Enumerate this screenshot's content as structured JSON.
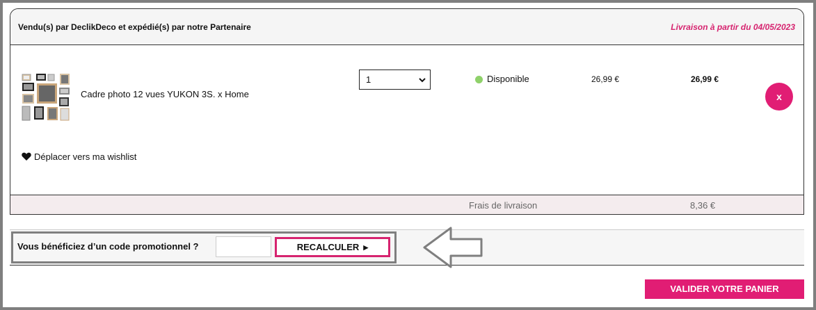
{
  "order": {
    "seller_line": "Vendu(s) par DeclikDeco et expédié(s) par notre Partenaire",
    "delivery_line": "Livraison à partir du 04/05/2023"
  },
  "item": {
    "name": "Cadre photo 12 vues YUKON 3S. x Home",
    "quantity": "1",
    "availability": "Disponible",
    "unit_price": "26,99 €",
    "total_price": "26,99 €",
    "remove_label": "x",
    "wishlist_label": "Déplacer vers ma wishlist",
    "availability_color": "#8fd16a"
  },
  "shipping": {
    "label": "Frais de livraison",
    "value": "8,36 €"
  },
  "promo": {
    "label": "Vous bénéficiez d’un code promotionnel ?",
    "input_value": "",
    "recalc_label": "RECALCULER",
    "recalc_icon": "triangle-right-icon"
  },
  "footer": {
    "validate_label": "VALIDER VOTRE PANIER"
  },
  "colors": {
    "accent": "#e11d74",
    "annotation_frame": "#7f7f7f"
  }
}
